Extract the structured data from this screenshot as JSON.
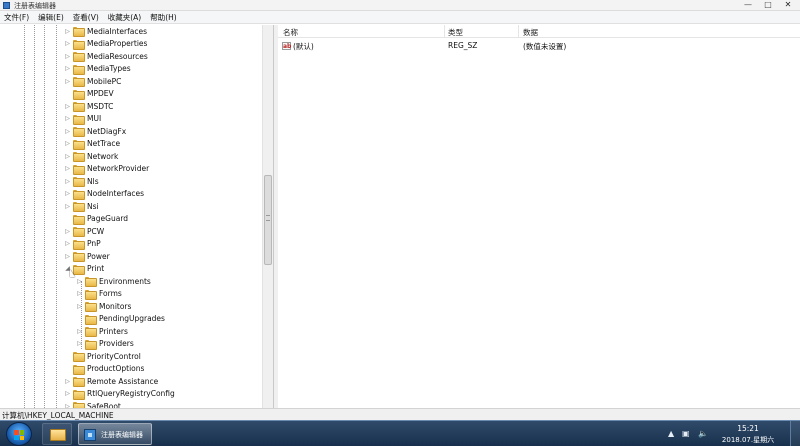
{
  "window": {
    "title": "注册表编辑器"
  },
  "menu": [
    {
      "id": "file",
      "label": "文件(F)"
    },
    {
      "id": "edit",
      "label": "编辑(E)"
    },
    {
      "id": "view",
      "label": "查看(V)"
    },
    {
      "id": "favorites",
      "label": "收藏夹(A)"
    },
    {
      "id": "help",
      "label": "帮助(H)"
    }
  ],
  "tree": {
    "items": [
      {
        "label": "MediaInterfaces",
        "level": 0,
        "expander": "collapsed"
      },
      {
        "label": "MediaProperties",
        "level": 0,
        "expander": "collapsed"
      },
      {
        "label": "MediaResources",
        "level": 0,
        "expander": "collapsed"
      },
      {
        "label": "MediaTypes",
        "level": 0,
        "expander": "collapsed"
      },
      {
        "label": "MobilePC",
        "level": 0,
        "expander": "collapsed"
      },
      {
        "label": "MPDEV",
        "level": 0,
        "expander": "none"
      },
      {
        "label": "MSDTC",
        "level": 0,
        "expander": "collapsed"
      },
      {
        "label": "MUI",
        "level": 0,
        "expander": "collapsed"
      },
      {
        "label": "NetDiagFx",
        "level": 0,
        "expander": "collapsed"
      },
      {
        "label": "NetTrace",
        "level": 0,
        "expander": "collapsed"
      },
      {
        "label": "Network",
        "level": 0,
        "expander": "collapsed"
      },
      {
        "label": "NetworkProvider",
        "level": 0,
        "expander": "collapsed"
      },
      {
        "label": "Nls",
        "level": 0,
        "expander": "collapsed"
      },
      {
        "label": "NodeInterfaces",
        "level": 0,
        "expander": "collapsed"
      },
      {
        "label": "Nsi",
        "level": 0,
        "expander": "collapsed"
      },
      {
        "label": "PageGuard",
        "level": 0,
        "expander": "none"
      },
      {
        "label": "PCW",
        "level": 0,
        "expander": "collapsed"
      },
      {
        "label": "PnP",
        "level": 0,
        "expander": "collapsed"
      },
      {
        "label": "Power",
        "level": 0,
        "expander": "collapsed"
      },
      {
        "label": "Print",
        "level": 0,
        "expander": "expanded"
      },
      {
        "label": "Environments",
        "level": 1,
        "expander": "collapsed"
      },
      {
        "label": "Forms",
        "level": 1,
        "expander": "collapsed"
      },
      {
        "label": "Monitors",
        "level": 1,
        "expander": "collapsed"
      },
      {
        "label": "PendingUpgrades",
        "level": 1,
        "expander": "none"
      },
      {
        "label": "Printers",
        "level": 1,
        "expander": "collapsed"
      },
      {
        "label": "Providers",
        "level": 1,
        "expander": "collapsed"
      },
      {
        "label": "PriorityControl",
        "level": 0,
        "expander": "none"
      },
      {
        "label": "ProductOptions",
        "level": 0,
        "expander": "none"
      },
      {
        "label": "Remote Assistance",
        "level": 0,
        "expander": "collapsed"
      },
      {
        "label": "RtlQueryRegistryConfig",
        "level": 0,
        "expander": "collapsed"
      },
      {
        "label": "SafeBoot",
        "level": 0,
        "expander": "collapsed"
      }
    ]
  },
  "values": {
    "columns": [
      "名称",
      "类型",
      "数据"
    ],
    "rows": [
      {
        "icon": "ab",
        "name": "(默认)",
        "type": "REG_SZ",
        "data": "(数值未设置)"
      }
    ]
  },
  "status": {
    "path": "计算机\\HKEY_LOCAL_MACHINE"
  },
  "taskbar": {
    "regedit_label": "注册表编辑器",
    "time": "15:21",
    "date": "2018.07.星期六"
  },
  "colors": {
    "taskbar": "#1f3754",
    "folder": "#e8b847"
  },
  "icons": {
    "app": "registry-editor-icon",
    "start": "windows-start-icon",
    "explorer": "explorer-folder-icon",
    "tray_up": "tray-arrow-icon",
    "tray_network": "network-icon",
    "tray_volume": "volume-icon"
  }
}
